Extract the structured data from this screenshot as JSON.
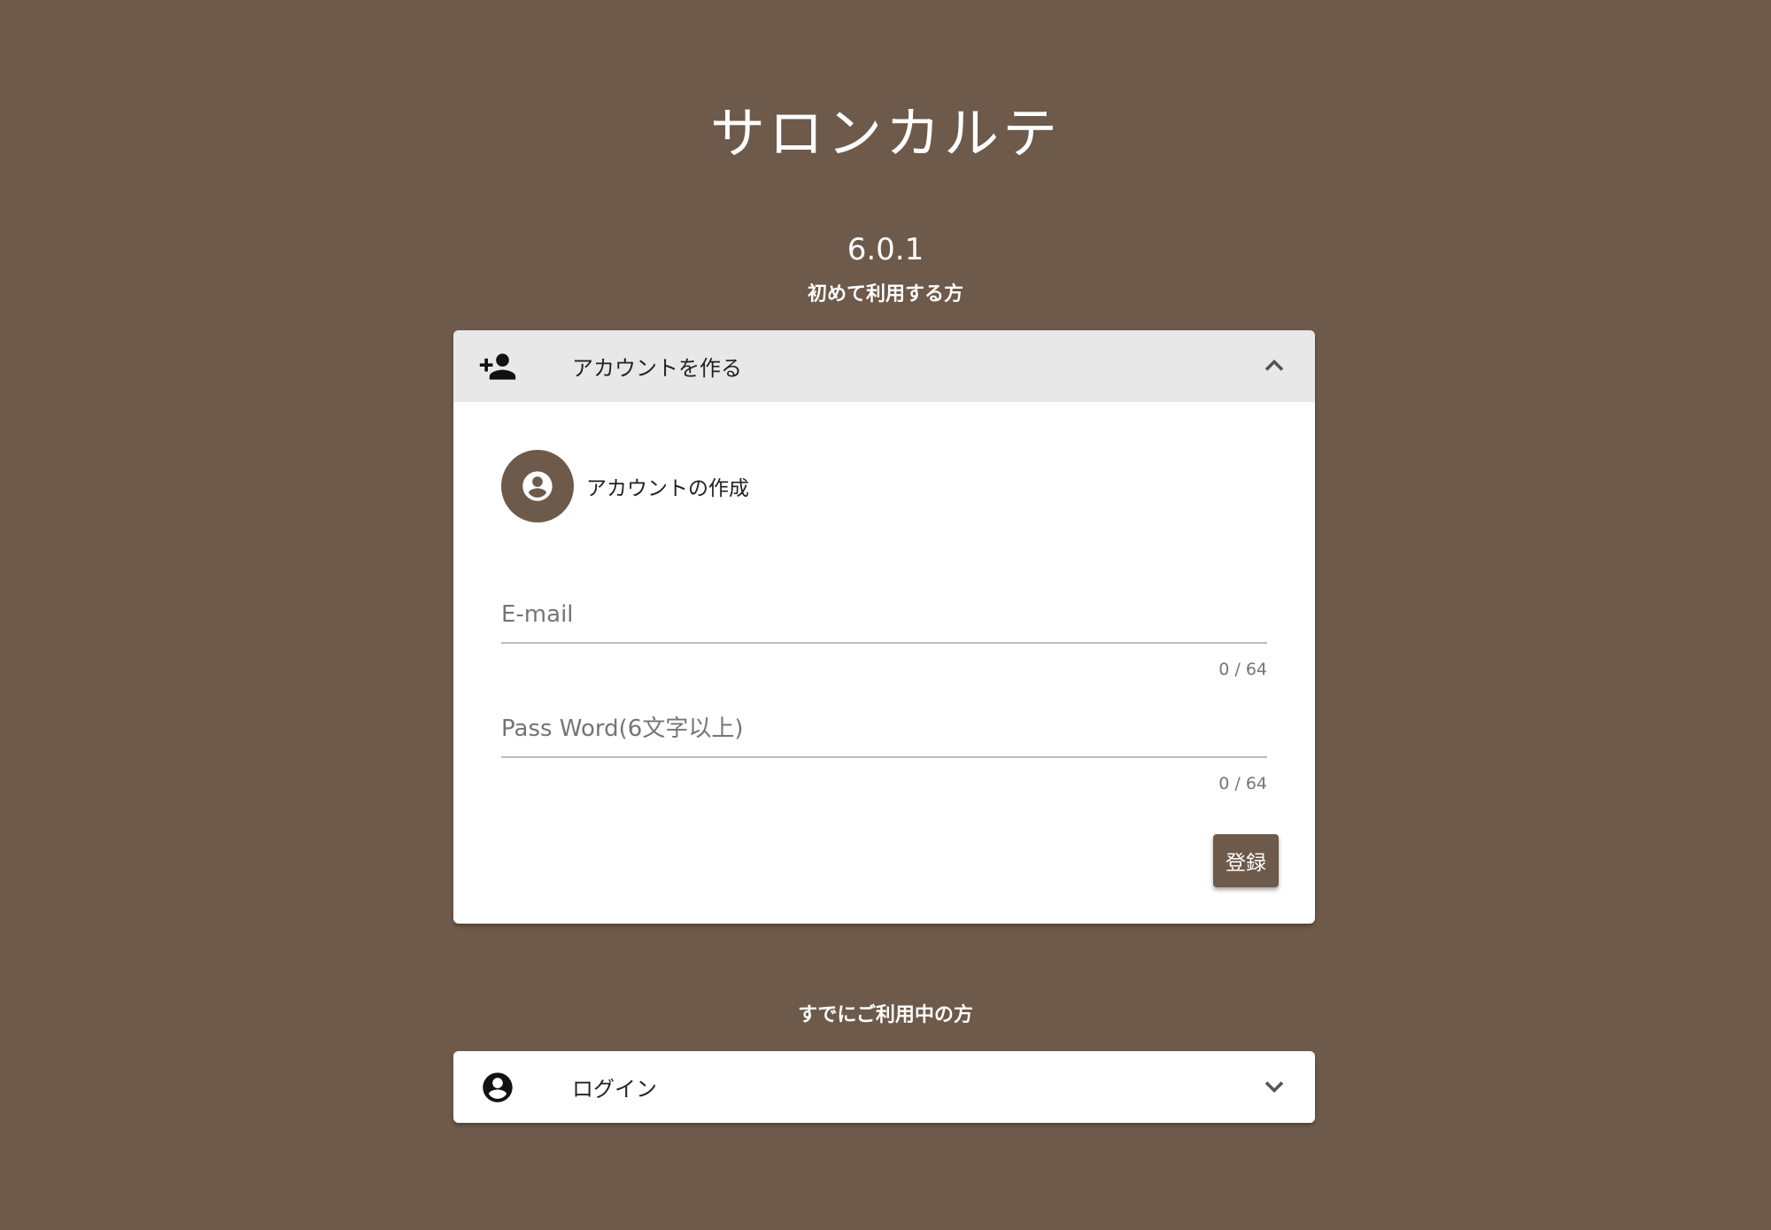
{
  "app": {
    "title": "サロンカルテ",
    "version": "6.0.1"
  },
  "new_user": {
    "section_label": "初めて利用する方",
    "panel_title": "アカウントを作る",
    "header_icon": "person-add-icon",
    "expanded": true,
    "step_icon": "account-circle-icon",
    "step_label": "アカウントの作成",
    "email": {
      "placeholder": "E-mail",
      "value": "",
      "counter": "0 / 64"
    },
    "password": {
      "placeholder": "Pass Word(6文字以上)",
      "value": "",
      "counter": "0 / 64"
    },
    "register_label": "登録"
  },
  "existing_user": {
    "section_label": "すでにご利用中の方",
    "panel_title": "ログイン",
    "header_icon": "account-circle-icon",
    "expanded": false
  },
  "colors": {
    "background": "#6e5a4a",
    "accent": "#6e5a4a",
    "header_active": "#e8e8e8"
  }
}
